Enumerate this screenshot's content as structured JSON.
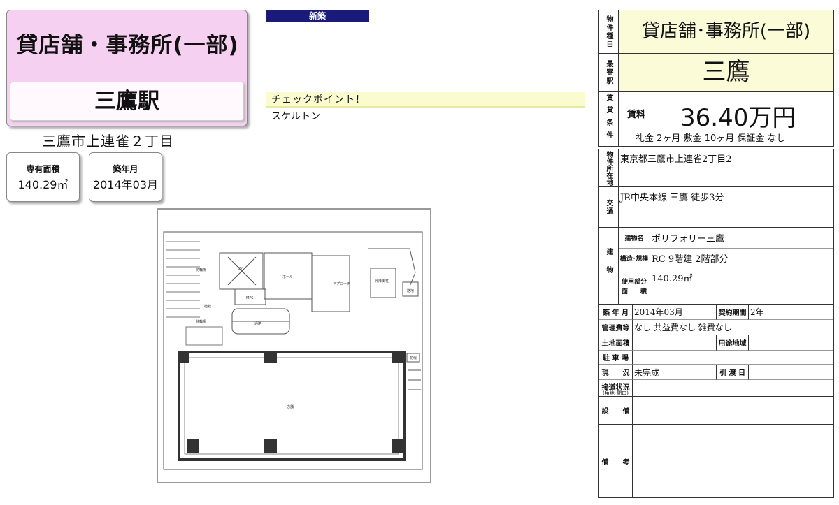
{
  "header": {
    "property_type": "貸店舗・事務所(一部)",
    "station": "三鷹駅",
    "address_short": "三鷹市上連雀２丁目",
    "new_badge": "新築"
  },
  "specs": [
    {
      "label": "専有面積",
      "value": "140.29㎡"
    },
    {
      "label": "築年月",
      "value": "2014年03月"
    }
  ],
  "checkpoint": {
    "title": "チェックポイント！",
    "body": "スケルトン"
  },
  "table": {
    "property_type_label": "物件種目",
    "property_type_value": "貸店舗･事務所(一部)",
    "station_label": "最寄駅",
    "station_value": "三鷹",
    "terms_label": "賃貸条件",
    "rent_label": "賃料",
    "rent_value": "36.40万円",
    "deposits": "礼金 2ヶ月  敷金 10ヶ月  保証金 なし",
    "location_label": "物件所在地",
    "location_value": "東京都三鷹市上連雀2丁目2",
    "transport_label": "交通",
    "transport_value": "JR中央本線 三鷹 徒歩3分",
    "building_label": "建物",
    "building_name_label": "建物名",
    "building_name_value": "ポリフォリー三鷹",
    "structure_label": "構造･規模",
    "structure_value": "RC 9階建 2階部分",
    "area_label_1": "使用部分",
    "area_label_2": "面　　積",
    "area_value": "140.29㎡",
    "built_label": "築 年 月",
    "built_value": "2014年03月",
    "contract_label": "契約期間",
    "contract_value": "2年",
    "fees_label": "管理費等",
    "fees_value": "なし  共益費なし  雑費なし",
    "land_label": "土地面積",
    "land_value": "",
    "zoning_label": "用途地域",
    "zoning_value": "",
    "parking_label": "駐 車 場",
    "parking_value": "",
    "status_label": "現　　況",
    "status_value": "未完成",
    "handover_label": "引 渡 日",
    "handover_value": "",
    "road_label": "接道状況",
    "road_sublabel": "(角地･間口)",
    "road_value": "",
    "equipment_label": "設　　備",
    "equipment_value": "",
    "remarks_label": "備　　考",
    "remarks_value": ""
  },
  "floorplan": {
    "labels": [
      "EV",
      "ホール",
      "アプローチ",
      "駐輪場",
      "MPS",
      "植栽",
      "通路",
      "防輪場",
      "店舗",
      "花壇",
      "路地",
      "昇降支柱"
    ]
  }
}
